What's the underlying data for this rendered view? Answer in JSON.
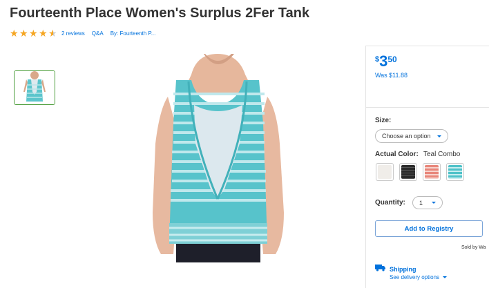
{
  "product": {
    "title": "Fourteenth Place Women's Surplus 2Fer Tank",
    "rating": 4.5,
    "reviews_label": "2 reviews",
    "qa_label": "Q&A",
    "by_label": "By: Fourteenth P..."
  },
  "price": {
    "currency": "$",
    "dollars": "3",
    "cents": "50",
    "was": "Was $11.88"
  },
  "size": {
    "label": "Size:",
    "placeholder": "Choose an option"
  },
  "color": {
    "label": "Actual Color:",
    "value": "Teal Combo",
    "swatches": [
      {
        "name": "white",
        "color": "#f0ede9"
      },
      {
        "name": "black",
        "color": "#2a2a2a"
      },
      {
        "name": "coral",
        "color": "#e8867a"
      },
      {
        "name": "teal",
        "color": "#4fc2c9"
      }
    ]
  },
  "quantity": {
    "label": "Quantity:",
    "value": "1"
  },
  "registry": {
    "label": "Add to Registry"
  },
  "sold_by": "Sold by Wa",
  "shipping": {
    "label": "Shipping",
    "link": "See delivery options"
  },
  "colors": {
    "accent": "#0071dc",
    "star": "#f5a623",
    "thumb_border": "#4b9d3a"
  }
}
